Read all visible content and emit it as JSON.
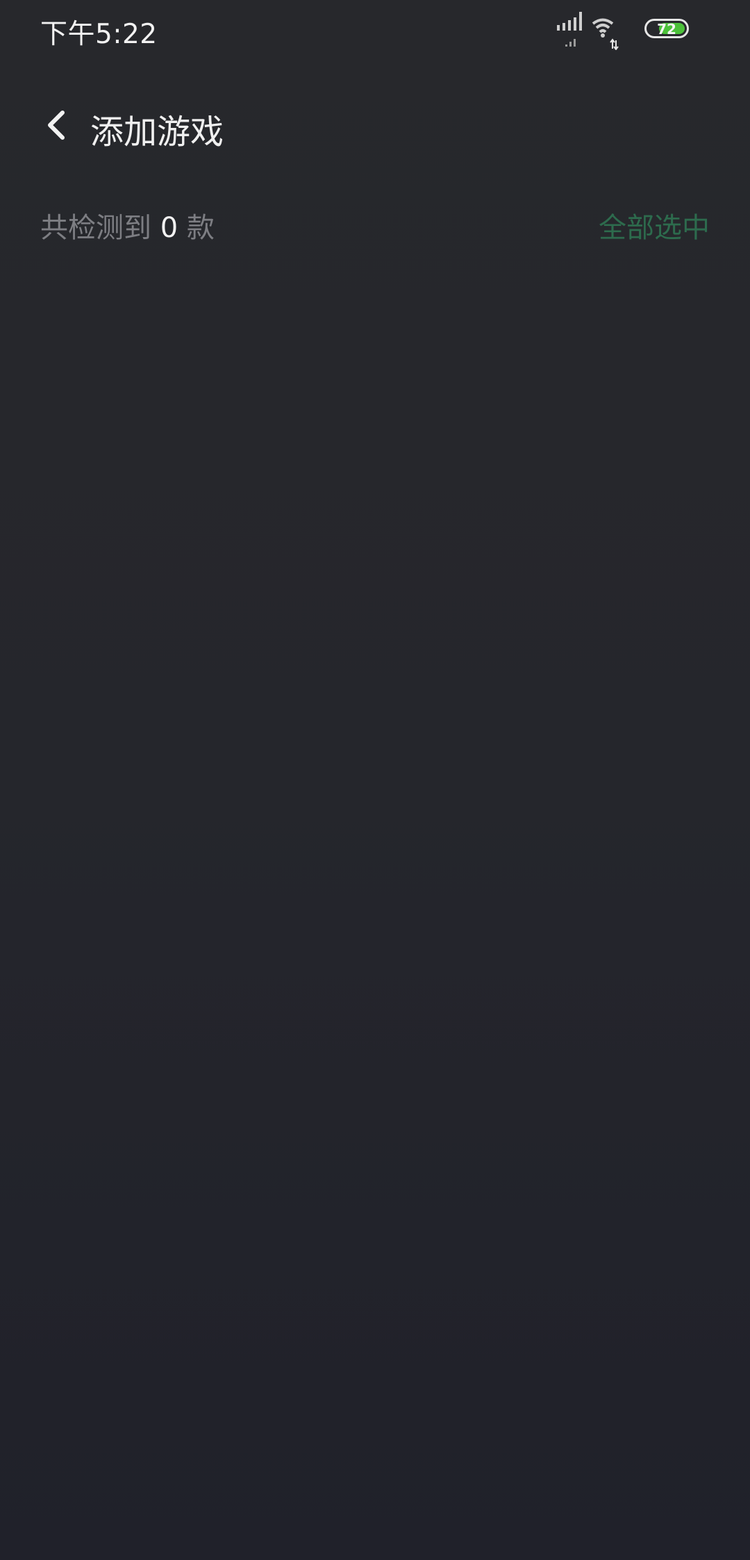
{
  "status_bar": {
    "time": "下午5:22",
    "battery_level": "72",
    "icons": [
      "signal-icon",
      "wifi-icon",
      "battery-icon"
    ]
  },
  "header": {
    "title": "添加游戏",
    "back_icon": "chevron-left-icon"
  },
  "summary": {
    "prefix": "共检测到",
    "count": "0",
    "suffix": "款",
    "select_all_label": "全部选中"
  },
  "colors": {
    "background": "#25262c",
    "accent": "#2d6b4d",
    "muted_text": "#7d7e83",
    "battery": "#4cc13a"
  }
}
